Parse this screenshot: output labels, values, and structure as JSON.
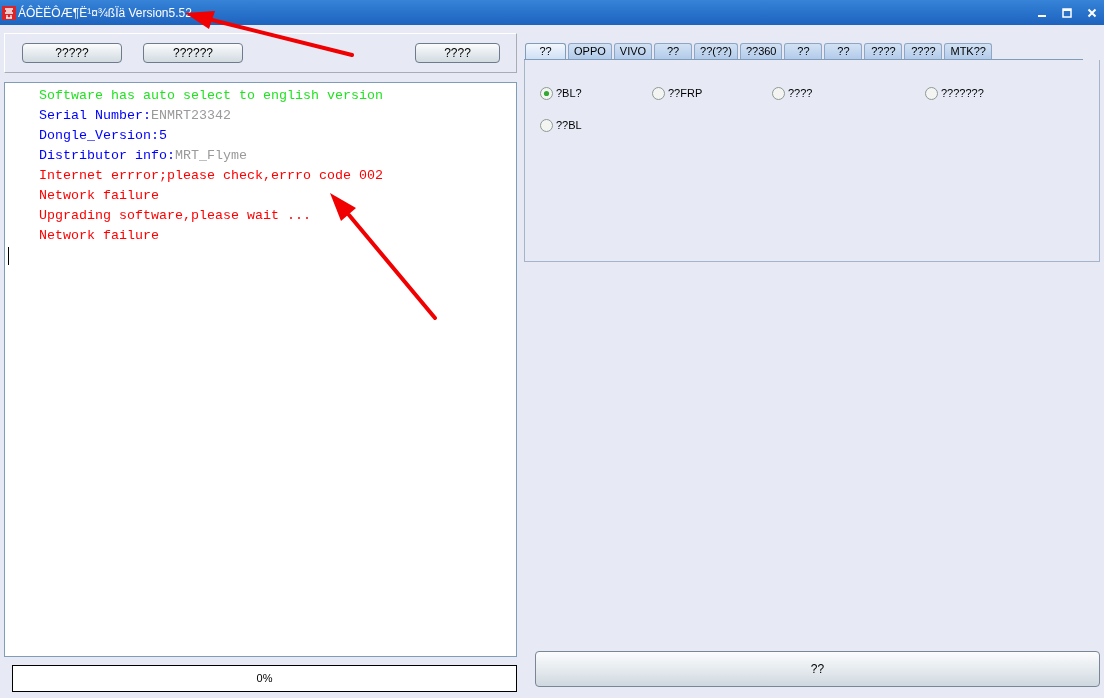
{
  "window": {
    "title": "ÁÔÈËÔÆ¶Ë¹¤¾ßÏä Version5.52"
  },
  "toolbar": {
    "buttons": [
      "?????",
      "??????",
      "????"
    ]
  },
  "log": {
    "lines": [
      {
        "kind": "notice",
        "text": "Software has auto select to english version"
      },
      {
        "kind": "field",
        "label": "Serial Number:",
        "value": "ENMRT23342"
      },
      {
        "kind": "info",
        "text": "Dongle_Version:5"
      },
      {
        "kind": "field",
        "label": "Distributor info:",
        "value": "MRT_Flyme"
      },
      {
        "kind": "error",
        "text": "Internet errror;please check,errro code 002"
      },
      {
        "kind": "error",
        "text": "Network failure"
      },
      {
        "kind": "error",
        "text": "Upgrading software,please wait ..."
      },
      {
        "kind": "error",
        "text": "Network failure"
      }
    ]
  },
  "progress": {
    "level": 0,
    "label": "0%"
  },
  "tabs": [
    {
      "label": "??",
      "selected": true
    },
    {
      "label": "OPPO",
      "selected": false
    },
    {
      "label": "VIVO",
      "selected": false
    },
    {
      "label": "??",
      "selected": false
    },
    {
      "label": "??(??)",
      "selected": false
    },
    {
      "label": "??360",
      "selected": false
    },
    {
      "label": "??",
      "selected": false
    },
    {
      "label": "??",
      "selected": false
    },
    {
      "label": "????",
      "selected": false
    },
    {
      "label": "????",
      "selected": false
    },
    {
      "label": "MTK??",
      "selected": false
    }
  ],
  "options": [
    {
      "label": "?BL?",
      "selected": true
    },
    {
      "label": "??FRP",
      "selected": false
    },
    {
      "label": "????",
      "selected": false
    },
    {
      "label": "???????",
      "selected": false
    },
    {
      "label": "??BL",
      "selected": false
    }
  ],
  "action_button": {
    "label": "??"
  }
}
